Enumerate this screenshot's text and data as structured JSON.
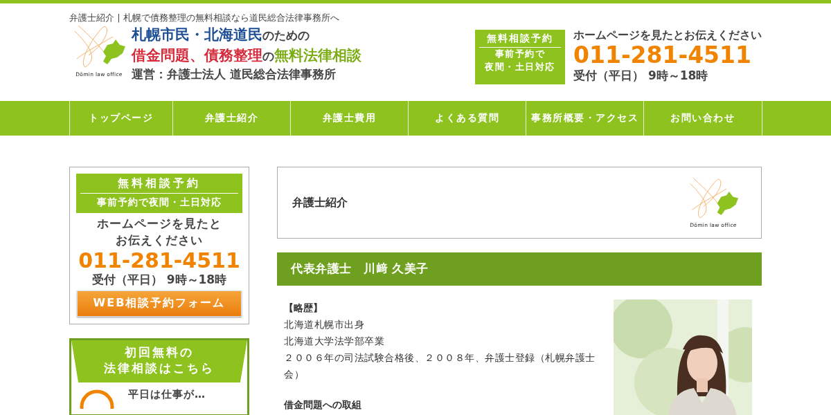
{
  "top_caption": "弁護士紹介 | 札幌で債務整理の無料相談なら道民総合法律事務所へ",
  "header": {
    "logo_text": "Dōmin law office",
    "tagline_line1": [
      "札幌市民・北海道民",
      "のための"
    ],
    "tagline_line2": [
      "借金問題、債務整理",
      "の",
      "無料法律相談"
    ],
    "operator": "運営：弁護士法人 道民総合法律事務所"
  },
  "header_contact": {
    "badge_title": "無料相談予約",
    "badge_lines": [
      "事前予約で",
      "夜間・土日対応"
    ],
    "note": "ホームページを見たとお伝えください",
    "phone": "011-281-4511",
    "hours": "受付（平日） 9時～18時"
  },
  "nav": [
    "トップページ",
    "弁護士紹介",
    "弁護士費用",
    "よくある質問",
    "事務所概要・アクセス",
    "お問い合わせ"
  ],
  "sidebar": {
    "reserve_card": {
      "title": "無料相談予約",
      "sub": "事前予約で夜間・土日対応",
      "note_lines": [
        "ホームページを見たと",
        "お伝えください"
      ],
      "phone": "011-281-4511",
      "hours": "受付（平日） 9時～18時",
      "button": "WEB相談予約フォーム"
    },
    "consult_card": {
      "heading_lines": [
        "初回無料の",
        "法律相談はこちら"
      ],
      "item": "平日は仕事が…"
    }
  },
  "content": {
    "page_title": "弁護士紹介",
    "logo_text": "Dōmin law office",
    "profile": {
      "heading": "代表弁護士　川﨑 久美子",
      "section_label": "【略歴】",
      "lines": [
        "北海道札幌市出身",
        "北海道大学法学部卒業",
        "２００６年の司法試験合格後、２００８年、弁護士登録（札幌弁護士会）"
      ],
      "subheading": "借金問題への取組"
    }
  }
}
